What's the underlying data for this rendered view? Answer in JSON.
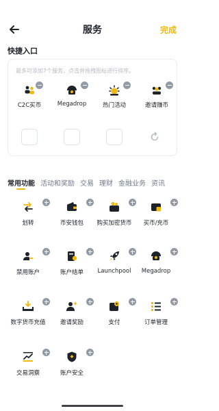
{
  "header": {
    "title": "服务",
    "done_label": "完成"
  },
  "quick_entry": {
    "title": "快捷入口",
    "hint": "最多可添加7个服务，点击并拖拽图标进行排序。",
    "items": [
      {
        "label": "C2C买币",
        "icon": "c2c-people-icon"
      },
      {
        "label": "Megadrop",
        "icon": "megadrop-icon"
      },
      {
        "label": "热门活动",
        "icon": "hot-activity-icon"
      },
      {
        "label": "邀请赚币",
        "icon": "invite-earn-icon"
      }
    ]
  },
  "tabs": [
    {
      "label": "常用功能",
      "active": true
    },
    {
      "label": "活动和奖励"
    },
    {
      "label": "交易"
    },
    {
      "label": "理财"
    },
    {
      "label": "金融业务"
    },
    {
      "label": "资讯"
    }
  ],
  "services": [
    {
      "label": "划转",
      "icon": "transfer-icon"
    },
    {
      "label": "币安钱包",
      "icon": "wallet-icon"
    },
    {
      "label": "购买加密货币",
      "icon": "buy-crypto-icon"
    },
    {
      "label": "买币/充币",
      "icon": "buy-deposit-icon"
    },
    {
      "label": "禁用账户",
      "icon": "disable-account-icon"
    },
    {
      "label": "账户结单",
      "icon": "account-statement-icon"
    },
    {
      "label": "Launchpool",
      "icon": "launchpool-rocket-icon"
    },
    {
      "label": "Megadrop",
      "icon": "megadrop-icon"
    },
    {
      "label": "数字货币充值",
      "icon": "crypto-deposit-icon"
    },
    {
      "label": "邀请奖励",
      "icon": "referral-icon"
    },
    {
      "label": "支付",
      "icon": "pay-icon"
    },
    {
      "label": "订单管理",
      "icon": "order-list-icon"
    },
    {
      "label": "交易洞察",
      "icon": "trade-insight-icon"
    },
    {
      "label": "账户安全",
      "icon": "account-security-icon"
    }
  ],
  "colors": {
    "accent": "#f0b90b",
    "text": "#1e2329",
    "muted": "#707a8a",
    "badge": "#929aa5"
  }
}
